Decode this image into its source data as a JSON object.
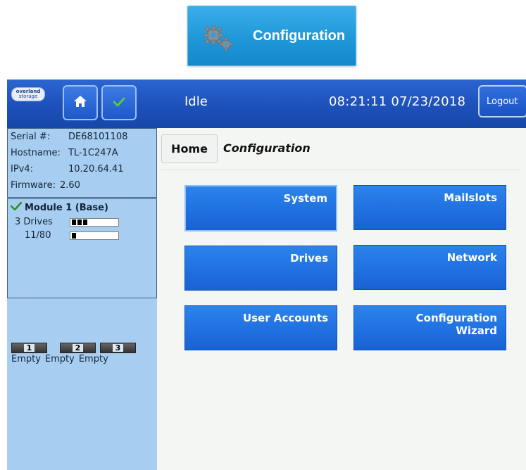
{
  "banner": {
    "label": "Configuration",
    "icon": "gears-icon"
  },
  "header": {
    "logo_text_1": "overland",
    "logo_text_2": "storage",
    "home_icon": "home-icon",
    "check_icon": "check-icon",
    "status": "Idle",
    "clock": "08:21:11  07/23/2018",
    "logout_label": "Logout"
  },
  "sidebar": {
    "info": [
      {
        "key": "Serial #:",
        "value": "DE68101108"
      },
      {
        "key": "Hostname:",
        "value": "TL-1C247A"
      },
      {
        "key": "IPv4:",
        "value": "10.20.64.41"
      },
      {
        "key": "Firmware:",
        "value": "2.60"
      }
    ],
    "module": {
      "title": "Module 1 (Base)",
      "drives_label": "3 Drives",
      "drives_filled": 3,
      "slots_label": "11/80",
      "slots_fraction": 0.1375,
      "bays": [
        {
          "number": "1",
          "state": "Empty"
        },
        {
          "number": "2",
          "state": "Empty"
        },
        {
          "number": "3",
          "state": "Empty"
        }
      ]
    }
  },
  "breadcrumb": {
    "home": "Home",
    "current": "Configuration"
  },
  "tiles": [
    {
      "label": "System"
    },
    {
      "label": "Mailslots"
    },
    {
      "label": "Drives"
    },
    {
      "label": "Network"
    },
    {
      "label": "User Accounts"
    },
    {
      "label": "Configuration",
      "label2": "Wizard"
    }
  ],
  "colors": {
    "topbar": "#1e52bd",
    "sidebar": "#a7cef0",
    "tile": "#1f6fe0",
    "banner": "#1f97d8"
  }
}
